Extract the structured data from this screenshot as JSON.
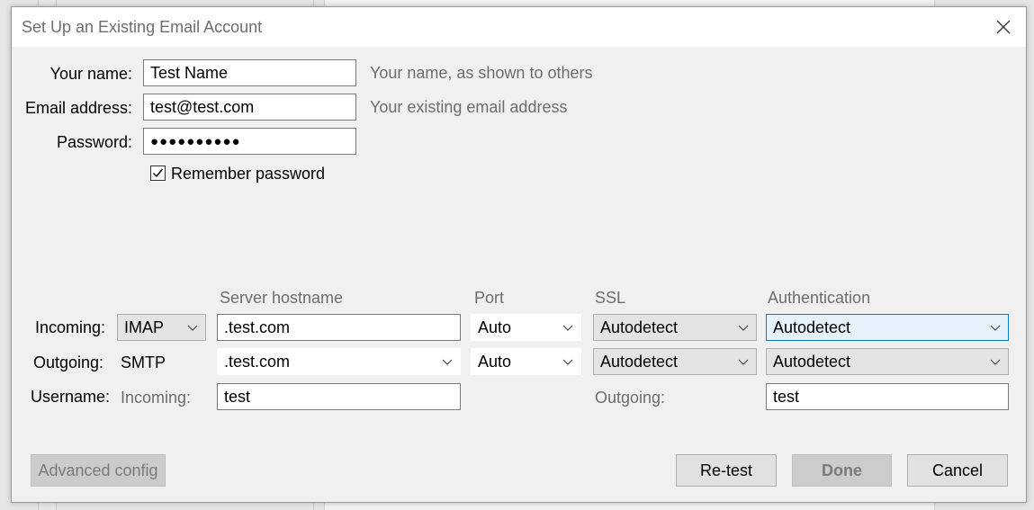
{
  "dialog": {
    "title": "Set Up an Existing Email Account"
  },
  "identity": {
    "name_label": "Your name:",
    "name_value": "Test Name",
    "name_hint": "Your name, as shown to others",
    "email_label": "Email address:",
    "email_value": "test@test.com",
    "email_hint": "Your existing email address",
    "password_label": "Password:",
    "password_value": "●●●●●●●●●●",
    "remember_label": "Remember password",
    "remember_checked": true
  },
  "server": {
    "headers": {
      "hostname": "Server hostname",
      "port": "Port",
      "ssl": "SSL",
      "auth": "Authentication"
    },
    "incoming": {
      "label": "Incoming:",
      "protocol": "IMAP",
      "hostname": ".test.com",
      "port": "Auto",
      "ssl": "Autodetect",
      "auth": "Autodetect"
    },
    "outgoing": {
      "label": "Outgoing:",
      "protocol": "SMTP",
      "hostname": ".test.com",
      "port": "Auto",
      "ssl": "Autodetect",
      "auth": "Autodetect"
    },
    "username": {
      "label": "Username:",
      "incoming_label": "Incoming:",
      "incoming_value": "test",
      "outgoing_label": "Outgoing:",
      "outgoing_value": "test"
    }
  },
  "buttons": {
    "advanced": "Advanced config",
    "retest": "Re-test",
    "done": "Done",
    "cancel": "Cancel"
  },
  "colors": {
    "focus_border": "#0078d7",
    "focus_bg": "#e5f1fb",
    "hint_text": "#6d6d6d"
  }
}
